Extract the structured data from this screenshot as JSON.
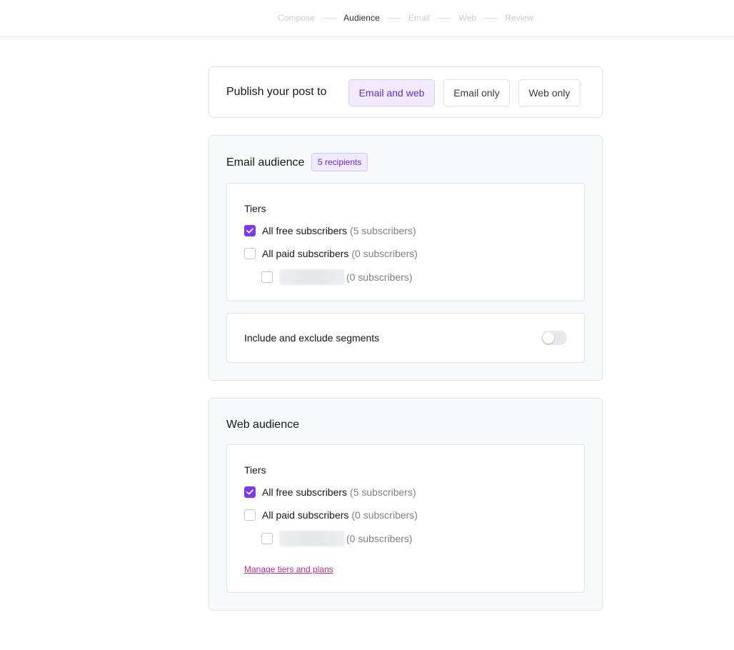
{
  "stepper": {
    "steps": [
      {
        "label": "Compose",
        "active": false
      },
      {
        "label": "Audience",
        "active": true
      },
      {
        "label": "Email",
        "active": false
      },
      {
        "label": "Web",
        "active": false
      },
      {
        "label": "Review",
        "active": false
      }
    ]
  },
  "publish": {
    "label": "Publish your post to",
    "options": [
      "Email and web",
      "Email only",
      "Web only"
    ],
    "selected": "Email and web"
  },
  "email_audience": {
    "title": "Email audience",
    "badge": "5 recipients",
    "tiers_title": "Tiers",
    "tiers": [
      {
        "label": "All free subscribers",
        "count": "(5 subscribers)",
        "checked": true
      },
      {
        "label": "All paid subscribers",
        "count": "(0 subscribers)",
        "checked": false
      },
      {
        "label": "",
        "count": "(0 subscribers)",
        "checked": false
      }
    ],
    "segments_label": "Include and exclude segments",
    "segments_enabled": false
  },
  "web_audience": {
    "title": "Web audience",
    "tiers_title": "Tiers",
    "tiers": [
      {
        "label": "All free subscribers",
        "count": "(5 subscribers)",
        "checked": true
      },
      {
        "label": "All paid subscribers",
        "count": "(0 subscribers)",
        "checked": false
      },
      {
        "label": "",
        "count": "(0 subscribers)",
        "checked": false
      }
    ],
    "manage_link": "Manage tiers and plans"
  },
  "colors": {
    "accent": "#7c3aed",
    "accent_text": "#6a2bd6",
    "link": "#c0288d"
  }
}
